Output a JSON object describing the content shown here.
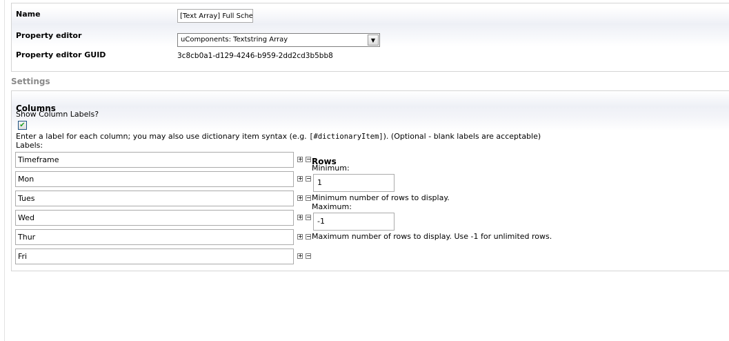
{
  "properties": {
    "name_label": "Name",
    "name_value": "[Text Array] Full Sche",
    "editor_label": "Property editor",
    "editor_value": "uComponents: Textstring Array",
    "guid_label": "Property editor GUID",
    "guid_value": "3c8cb0a1-d129-4246-b959-2dd2cd3b5bb8"
  },
  "settings": {
    "title": "Settings",
    "columns": {
      "heading": "Columns",
      "show_labels": "Show Column Labels?",
      "checked_glyph": "✔",
      "instructions_before": "Enter a label for each column; you may also use dictionary item syntax (e.g. ",
      "instructions_code": "[#dictionaryItem]",
      "instructions_after": "). (Optional - blank labels are acceptable)",
      "labels_label": "Labels:",
      "labels": [
        "Timeframe",
        "Mon",
        "Tues",
        "Wed",
        "Thur",
        "Fri"
      ],
      "add_glyph": "+",
      "remove_glyph": "−"
    },
    "rows": {
      "heading": "Rows",
      "min_label": "Minimum:",
      "min_value": "1",
      "min_help": "Minimum number of rows to display.",
      "max_label": "Maximum:",
      "max_value": "-1",
      "max_help": "Maximum number of rows to display. Use -1 for unlimited rows."
    }
  },
  "icons": {
    "dropdown": "▼"
  }
}
